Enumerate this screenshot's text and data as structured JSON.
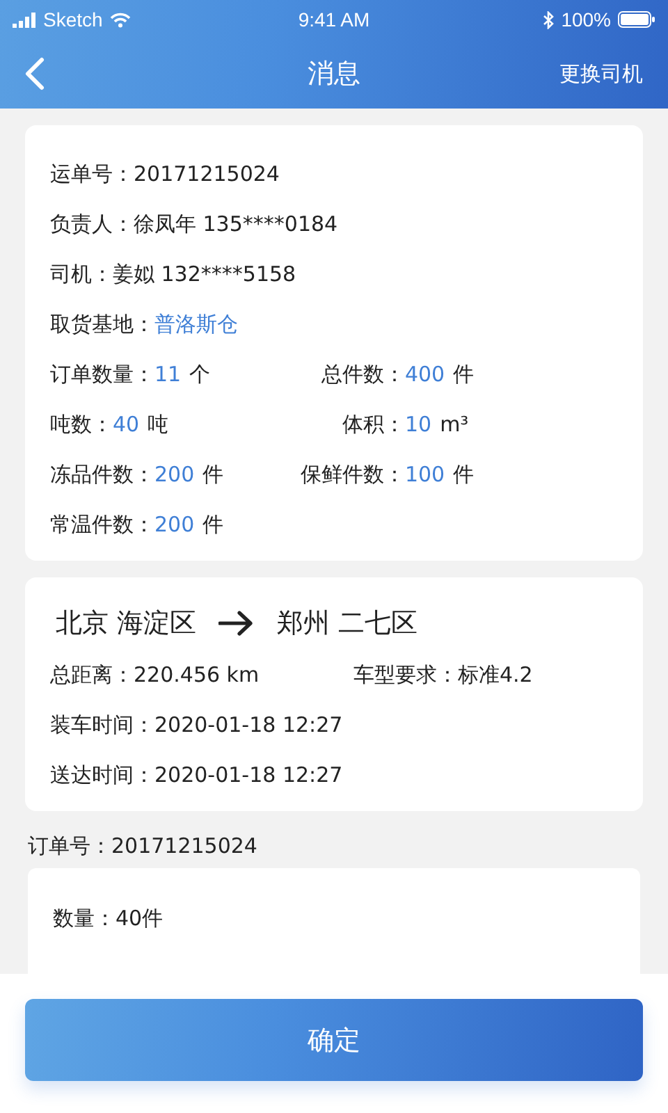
{
  "status_bar": {
    "carrier": "Sketch",
    "time": "9:41 AM",
    "battery": "100%"
  },
  "nav": {
    "title": "消息",
    "action": "更换司机"
  },
  "waybill": {
    "rows": [
      {
        "cells": [
          {
            "label": "运单号：",
            "value": "20171215024",
            "kind": "plain"
          }
        ]
      },
      {
        "cells": [
          {
            "label": "负责人：",
            "value": "徐凤年 135****0184",
            "kind": "plain"
          }
        ]
      },
      {
        "cells": [
          {
            "label": "司机：",
            "value": "姜姒 132****5158",
            "kind": "plain"
          }
        ]
      },
      {
        "cells": [
          {
            "label": "取货基地：",
            "value": "普洛斯仓",
            "kind": "accent"
          }
        ]
      },
      {
        "cells": [
          {
            "label": "订单数量：",
            "value": "11",
            "unit": "个",
            "kind": "accent"
          },
          {
            "label": "总件数：",
            "value": "400",
            "unit": "件",
            "kind": "accent"
          }
        ]
      },
      {
        "cells": [
          {
            "label": "吨数：",
            "value": "40",
            "unit": "吨",
            "kind": "accent"
          },
          {
            "label": "体积：",
            "value": "10",
            "unit": "m³",
            "kind": "accent"
          }
        ]
      },
      {
        "cells": [
          {
            "label": "冻品件数：",
            "value": "200",
            "unit": "件",
            "kind": "accent"
          },
          {
            "label": "保鲜件数：",
            "value": "100",
            "unit": "件",
            "kind": "accent"
          }
        ]
      },
      {
        "cells": [
          {
            "label": "常温件数：",
            "value": "200",
            "unit": "件",
            "kind": "accent"
          }
        ]
      }
    ]
  },
  "route": {
    "from": "北京 海淀区",
    "to": "郑州 二七区",
    "rows": [
      {
        "cells": [
          {
            "label": "总距离：",
            "value": "220.456 km"
          },
          {
            "label": "车型要求：",
            "value": "标准4.2"
          }
        ]
      },
      {
        "cells": [
          {
            "label": "装车时间：",
            "value": "2020-01-18 12:27"
          }
        ]
      },
      {
        "cells": [
          {
            "label": "送达时间：",
            "value": "2020-01-18 12:27"
          }
        ]
      }
    ]
  },
  "order": {
    "label": "订单号：",
    "number": "20171215024",
    "rows": [
      {
        "label": "数量：",
        "value": "40件"
      }
    ]
  },
  "confirm_button": "确定"
}
